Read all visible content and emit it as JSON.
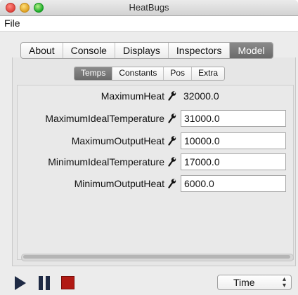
{
  "window": {
    "title": "HeatBugs"
  },
  "menu": {
    "file": "File"
  },
  "tabs": [
    {
      "label": "About"
    },
    {
      "label": "Console"
    },
    {
      "label": "Displays"
    },
    {
      "label": "Inspectors"
    },
    {
      "label": "Model",
      "active": true
    }
  ],
  "subtabs": [
    {
      "label": "Temps",
      "active": true
    },
    {
      "label": "Constants"
    },
    {
      "label": "Pos"
    },
    {
      "label": "Extra"
    }
  ],
  "properties": [
    {
      "name": "MaximumHeat",
      "value": "32000.0",
      "editable": false
    },
    {
      "name": "MaximumIdealTemperature",
      "value": "31000.0",
      "editable": true
    },
    {
      "name": "MaximumOutputHeat",
      "value": "10000.0",
      "editable": true
    },
    {
      "name": "MinimumIdealTemperature",
      "value": "17000.0",
      "editable": true
    },
    {
      "name": "MinimumOutputHeat",
      "value": "6000.0",
      "editable": true
    }
  ],
  "footer": {
    "time_select": {
      "selected": "Time"
    }
  },
  "colors": {
    "play": "#1e2a44",
    "stop": "#b11a14",
    "active_tab": "#7a7a7a"
  },
  "icons": {
    "inspect": "wrench-icon",
    "play": "play-icon",
    "pause": "pause-icon",
    "stop": "stop-icon"
  }
}
